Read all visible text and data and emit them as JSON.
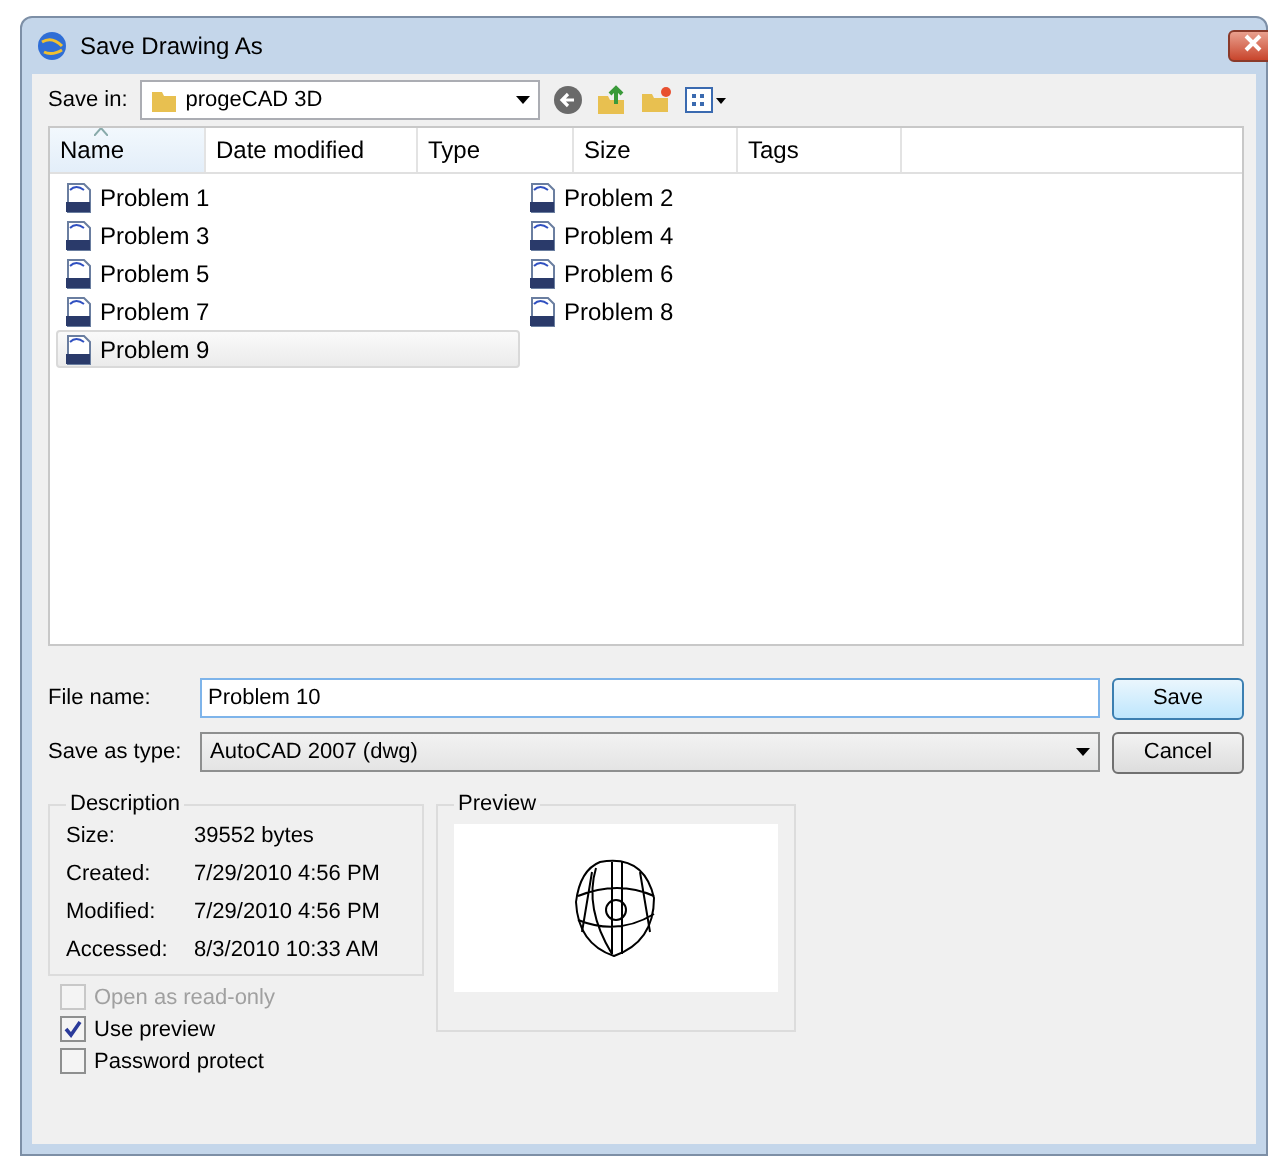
{
  "window": {
    "title": "Save Drawing As"
  },
  "save_in": {
    "label": "Save in:",
    "value": "progeCAD 3D"
  },
  "columns": [
    {
      "label": "Name",
      "sorted": true
    },
    {
      "label": "Date modified",
      "sorted": false
    },
    {
      "label": "Type",
      "sorted": false
    },
    {
      "label": "Size",
      "sorted": false
    },
    {
      "label": "Tags",
      "sorted": false
    }
  ],
  "files": [
    {
      "name": "Problem 1",
      "selected": false
    },
    {
      "name": "Problem 2",
      "selected": false
    },
    {
      "name": "Problem 3",
      "selected": false
    },
    {
      "name": "Problem 4",
      "selected": false
    },
    {
      "name": "Problem 5",
      "selected": false
    },
    {
      "name": "Problem 6",
      "selected": false
    },
    {
      "name": "Problem 7",
      "selected": false
    },
    {
      "name": "Problem 8",
      "selected": false
    },
    {
      "name": "Problem 9",
      "selected": true
    }
  ],
  "file_name": {
    "label": "File name:",
    "value": "Problem 10"
  },
  "save_as_type": {
    "label": "Save as type:",
    "value": "AutoCAD 2007 (dwg)"
  },
  "buttons": [
    {
      "label": "Save",
      "default": true
    },
    {
      "label": "Cancel",
      "default": false
    }
  ],
  "description": {
    "title": "Description",
    "rows": [
      {
        "label": "Size:",
        "value": "39552 bytes"
      },
      {
        "label": "Created:",
        "value": "7/29/2010 4:56 PM"
      },
      {
        "label": "Modified:",
        "value": "7/29/2010 4:56 PM"
      },
      {
        "label": "Accessed:",
        "value": "8/3/2010 10:33 AM"
      }
    ]
  },
  "preview": {
    "title": "Preview"
  },
  "options": [
    {
      "label": "Open as read-only",
      "checked": false,
      "disabled": true
    },
    {
      "label": "Use preview",
      "checked": true,
      "disabled": false
    },
    {
      "label": "Password protect",
      "checked": false,
      "disabled": false
    }
  ]
}
